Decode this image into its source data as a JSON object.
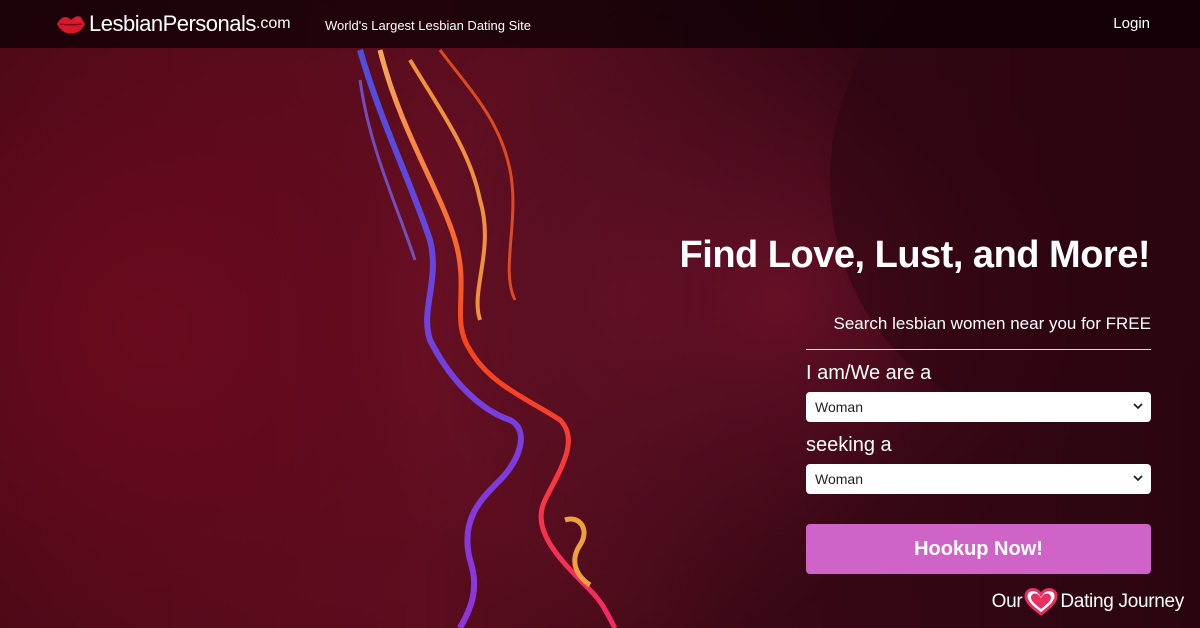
{
  "header": {
    "logo_text": "LesbianPersonals",
    "logo_suffix": ".com",
    "tagline": "World's Largest Lesbian Dating Site",
    "login_label": "Login"
  },
  "hero": {
    "headline": "Find Love, Lust, and More!"
  },
  "form": {
    "subhead": "Search lesbian women near you for FREE",
    "iam_label": "I am/We are a",
    "iam_value": "Woman",
    "seeking_label": "seeking a",
    "seeking_value": "Woman",
    "submit_label": "Hookup Now!"
  },
  "watermark": {
    "left": "Our",
    "right": "Dating Journey"
  },
  "colors": {
    "accent": "#d063c8",
    "brand_red": "#d9162c",
    "background": "#4a0916"
  },
  "icons": {
    "logo": "lips-icon",
    "select_arrow": "chevron-down-icon",
    "watermark": "heart-icon"
  }
}
